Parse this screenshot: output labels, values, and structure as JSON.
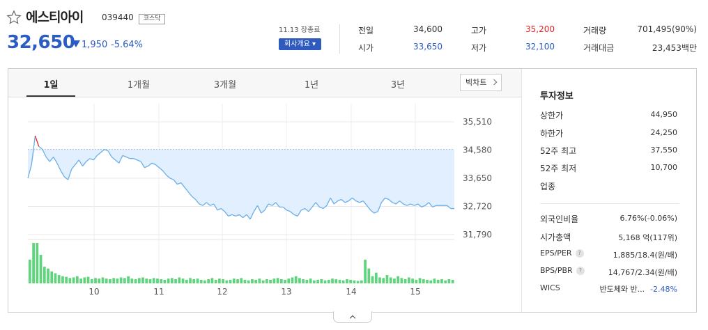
{
  "stock": {
    "name": "에스티아이",
    "code": "039440",
    "market": "코스닥",
    "price": "32,650",
    "change": "1,950",
    "change_rate": "-5.64%",
    "direction": "down"
  },
  "session": {
    "time": "11.13 장종료",
    "company_button": "회사개요 ▾"
  },
  "quote": {
    "prev_close": {
      "label": "전일",
      "value": "34,600"
    },
    "open": {
      "label": "시가",
      "value": "33,650"
    },
    "high": {
      "label": "고가",
      "value": "35,200"
    },
    "low": {
      "label": "저가",
      "value": "32,100"
    },
    "volume": {
      "label": "거래량",
      "value": "701,495(90%)"
    },
    "amount": {
      "label": "거래대금",
      "value": "23,453백만"
    }
  },
  "tabs": [
    "1일",
    "1개월",
    "3개월",
    "1년",
    "3년"
  ],
  "active_tab": "1일",
  "bigchart_label": "빅차트",
  "info": {
    "title": "투자정보",
    "upper_limit": {
      "label": "상한가",
      "value": "44,950"
    },
    "lower_limit": {
      "label": "하한가",
      "value": "24,250"
    },
    "high_52w": {
      "label": "52주 최고",
      "value": "37,550"
    },
    "low_52w": {
      "label": "52주 최저",
      "value": "10,700"
    },
    "industry": {
      "label": "업종",
      "value": ""
    },
    "foreign_ratio": {
      "label": "외국인비율",
      "value": "6.76%(-0.06%)"
    },
    "market_cap": {
      "label": "시가총액",
      "value": "5,168 억(117위)"
    },
    "eps_per": {
      "label": "EPS/PER",
      "value": "1,885/18.4(원/배)"
    },
    "bps_pbr": {
      "label": "BPS/PBR",
      "value": "14,767/2.34(원/배)"
    },
    "wics": {
      "label": "WICS",
      "name": "반도체와 반...",
      "rate": "-2.48%"
    }
  },
  "colors": {
    "up": "#e0242a",
    "down": "#2a5cc4",
    "area": "#e1efff",
    "volume": "#5fd47c"
  },
  "chart_data": {
    "type": "line",
    "x_ticks": [
      "10",
      "11",
      "12",
      "13",
      "14",
      "15"
    ],
    "y_ticks": [
      "35,510",
      "34,580",
      "33,650",
      "32,720",
      "31,790"
    ],
    "ylim": [
      31790,
      35510
    ],
    "prev_close": 34600,
    "price_series": [
      33650,
      34100,
      35050,
      34700,
      34600,
      34350,
      34200,
      34350,
      34150,
      33900,
      33700,
      33600,
      33950,
      34100,
      34250,
      34050,
      34200,
      34300,
      34250,
      34400,
      34500,
      34600,
      34550,
      34350,
      34250,
      34150,
      34400,
      34350,
      34300,
      34300,
      34250,
      34200,
      34000,
      34050,
      34150,
      34100,
      34000,
      33900,
      33750,
      33650,
      33600,
      33450,
      33500,
      33350,
      33200,
      33050,
      32950,
      32800,
      32750,
      32850,
      32750,
      32800,
      32600,
      32650,
      32550,
      32400,
      32450,
      32400,
      32450,
      32350,
      32450,
      32300,
      32550,
      32750,
      32500,
      32600,
      32800,
      32750,
      32850,
      32700,
      32700,
      32600,
      32550,
      32450,
      32400,
      32600,
      32650,
      32550,
      32700,
      32850,
      32700,
      32650,
      32750,
      33000,
      32800,
      32900,
      32950,
      32850,
      32900,
      33000,
      32900,
      32850,
      32900,
      32750,
      32600,
      32500,
      32550,
      32850,
      33000,
      32950,
      32850,
      32800,
      32900,
      32800,
      32750,
      32800,
      32750,
      32800,
      32700,
      32750,
      32850,
      32700,
      32750,
      32750,
      32750,
      32750,
      32650,
      32650
    ],
    "volume_series": [
      40,
      68,
      68,
      48,
      28,
      25,
      20,
      17,
      14,
      12,
      11,
      9,
      10,
      12,
      8,
      10,
      11,
      7,
      9,
      8,
      10,
      8,
      7,
      9,
      8,
      10,
      9,
      12,
      8,
      7,
      9,
      10,
      8,
      7,
      9,
      8,
      7,
      6,
      8,
      9,
      7,
      10,
      8,
      6,
      9,
      7,
      8,
      6,
      5,
      7,
      9,
      6,
      8,
      7,
      5,
      6,
      8,
      7,
      9,
      6,
      5,
      7,
      6,
      8,
      5,
      7,
      6,
      8,
      9,
      7,
      6,
      8,
      10,
      12,
      9,
      7,
      6,
      8,
      5,
      6,
      7,
      5,
      6,
      8,
      7,
      6,
      5,
      7,
      6,
      5,
      4,
      5,
      40,
      25,
      12,
      18,
      10,
      9,
      14,
      10,
      8,
      12,
      9,
      7,
      10,
      8,
      6,
      9,
      7,
      6,
      5,
      8,
      6,
      7,
      5,
      7,
      6
    ]
  }
}
